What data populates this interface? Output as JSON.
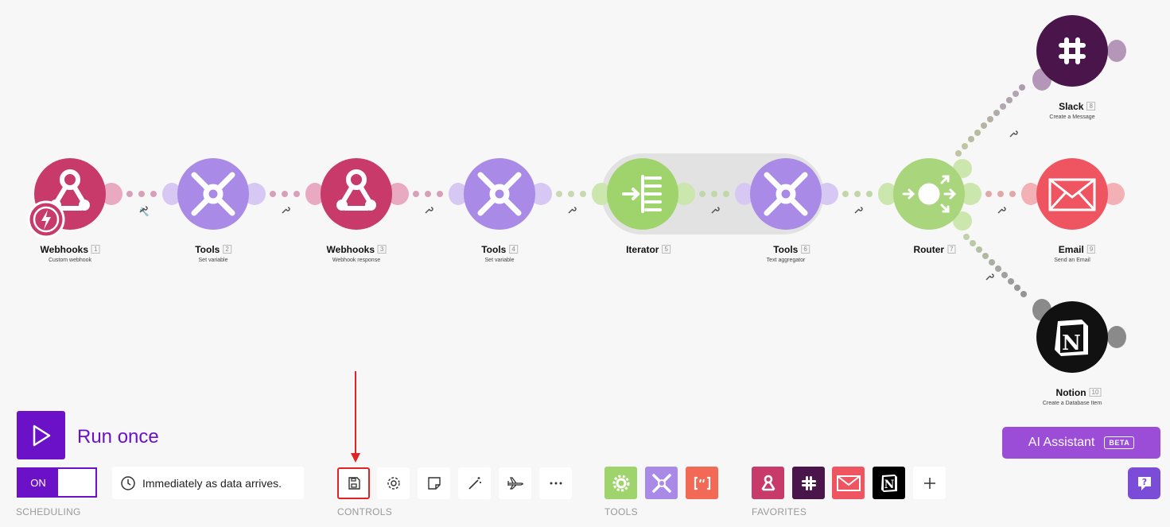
{
  "nodes": [
    {
      "name": "Webhooks",
      "num": "1",
      "sub": "Custom webhook"
    },
    {
      "name": "Tools",
      "num": "2",
      "sub": "Set variable"
    },
    {
      "name": "Webhooks",
      "num": "3",
      "sub": "Webhook response"
    },
    {
      "name": "Tools",
      "num": "4",
      "sub": "Set variable"
    },
    {
      "name": "Iterator",
      "num": "5",
      "sub": ""
    },
    {
      "name": "Tools",
      "num": "6",
      "sub": "Text aggregator"
    },
    {
      "name": "Router",
      "num": "7",
      "sub": ""
    },
    {
      "name": "Slack",
      "num": "8",
      "sub": "Create a Message"
    },
    {
      "name": "Email",
      "num": "9",
      "sub": "Send an Email"
    },
    {
      "name": "Notion",
      "num": "10",
      "sub": "Create a Database Item"
    }
  ],
  "run": {
    "label": "Run once"
  },
  "scheduling": {
    "toggle": "ON",
    "text": "Immediately as data arrives.",
    "section": "SCHEDULING"
  },
  "controls": {
    "section": "CONTROLS",
    "buttons": [
      "save-icon",
      "gear-icon",
      "note-icon",
      "magic-wand-icon",
      "airplane-icon",
      "more-icon"
    ]
  },
  "tools": {
    "section": "TOOLS"
  },
  "favorites": {
    "section": "FAVORITES"
  },
  "ai": {
    "label": "AI Assistant",
    "badge": "BETA"
  },
  "colors": {
    "webhooks": "#c83a6a",
    "tools": "#a98ae6",
    "iterator": "#9fd36c",
    "router": "#a9d67c",
    "slack": "#4a154b",
    "email": "#ef5561",
    "notion": "#111111",
    "accent": "#6b12c9",
    "highlight": "#e02424"
  }
}
